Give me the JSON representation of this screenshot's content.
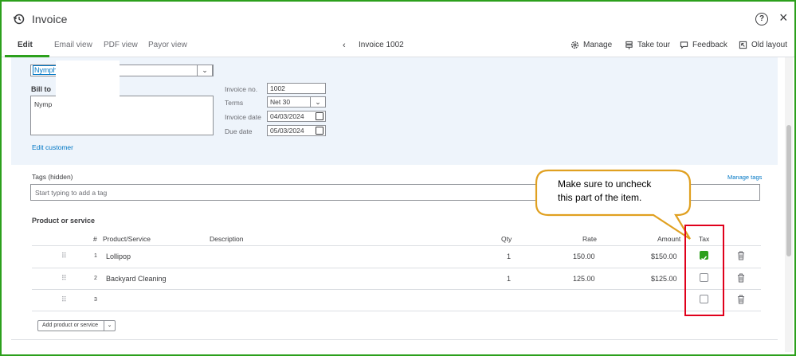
{
  "window": {
    "title": "Invoice",
    "help_icon": "?",
    "close_icon": "×"
  },
  "tabs": [
    {
      "label": "Edit",
      "active": true
    },
    {
      "label": "Email view"
    },
    {
      "label": "PDF view"
    },
    {
      "label": "Payor view"
    }
  ],
  "nav": {
    "prev_icon": "‹",
    "invoice_label": "Invoice 1002"
  },
  "actions": {
    "manage": "Manage",
    "take_tour": "Take tour",
    "feedback": "Feedback",
    "old_layout": "Old layout"
  },
  "customer": {
    "selected": "Nymph",
    "bill_to_label": "Bill to",
    "bill_to_text": "Nymp",
    "edit_customer": "Edit customer"
  },
  "invoice_fields": {
    "invoice_no_label": "Invoice no.",
    "invoice_no": "1002",
    "terms_label": "Terms",
    "terms": "Net 30",
    "invoice_date_label": "Invoice date",
    "invoice_date": "04/03/2024",
    "due_date_label": "Due date",
    "due_date": "05/03/2024"
  },
  "tags": {
    "label": "Tags (hidden)",
    "manage": "Manage tags",
    "placeholder": "Start typing to add a tag"
  },
  "products": {
    "section_title": "Product or service",
    "headers": {
      "num": "#",
      "product": "Product/Service",
      "description": "Description",
      "qty": "Qty",
      "rate": "Rate",
      "amount": "Amount",
      "tax": "Tax"
    },
    "rows": [
      {
        "num": "1",
        "product": "Lollipop",
        "qty": "1",
        "rate": "150.00",
        "amount": "$150.00",
        "tax": true
      },
      {
        "num": "2",
        "product": "Backyard Cleaning",
        "qty": "1",
        "rate": "125.00",
        "amount": "$125.00",
        "tax": false
      },
      {
        "num": "3",
        "product": "",
        "qty": "",
        "rate": "",
        "amount": "",
        "tax": false
      }
    ],
    "add_button": "Add product or service"
  },
  "callout": {
    "line1": "Make sure to uncheck",
    "line2": "this part of the item."
  },
  "colors": {
    "accent": "#2ca01c",
    "link": "#0077c5",
    "highlight": "#e0001b",
    "callout_border": "#e0a020"
  }
}
